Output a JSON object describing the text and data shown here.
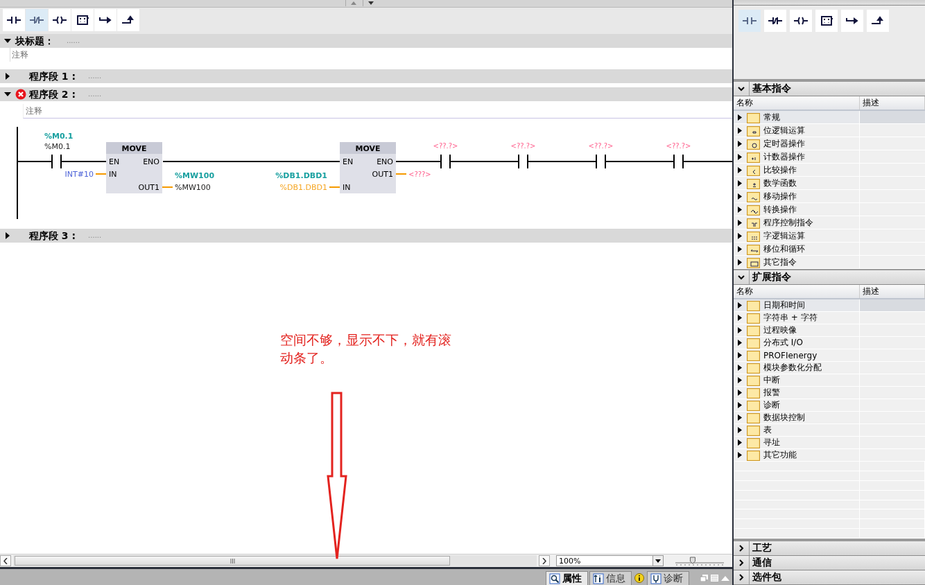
{
  "editor_toolbar": [
    {
      "kind": "no_contact",
      "selected": false
    },
    {
      "kind": "nc_contact",
      "selected": true
    },
    {
      "kind": "coil",
      "selected": false
    },
    {
      "kind": "empty_box",
      "selected": false
    },
    {
      "kind": "open_branch",
      "selected": false
    },
    {
      "kind": "close_branch",
      "selected": false
    }
  ],
  "block_title": {
    "label": "块标题：",
    "value": "......",
    "expanded": true,
    "comment": "注释"
  },
  "networks": [
    {
      "label": "程序段 1 :",
      "value": "......",
      "expanded": false,
      "error": false
    },
    {
      "label": "程序段 2 :",
      "value": "......",
      "expanded": true,
      "error": true,
      "comment": "注释"
    },
    {
      "label": "程序段 3 :",
      "value": "......",
      "expanded": false,
      "error": false
    }
  ],
  "ladder": {
    "contact_symbol": "%M0.1",
    "contact_address": "%M0.1",
    "move_boxes": [
      {
        "title": "MOVE",
        "en": "EN",
        "eno": "ENO",
        "in": "IN",
        "out": "OUT1",
        "in_operand": {
          "text": "INT#10",
          "kind": "constant"
        },
        "out_symbol": "%MW100",
        "out_operand": {
          "text": "%MW100",
          "kind": "address"
        }
      },
      {
        "title": "MOVE",
        "en": "EN",
        "eno": "ENO",
        "in": "IN",
        "out": "OUT1",
        "in_symbol": "%DB1.DBD1",
        "in_operand": {
          "text": "%DB1.DBD1",
          "kind": "db"
        },
        "out_operand": {
          "text": "<???>",
          "kind": "missing"
        }
      }
    ],
    "empty_contacts": [
      {
        "operand": "<??.?>"
      },
      {
        "operand": "<??.?>"
      },
      {
        "operand": "<??.?>"
      },
      {
        "operand": "<??.?>"
      }
    ]
  },
  "annotation": {
    "text": "空间不够，显示不下，就有滚动条了。"
  },
  "zoom": {
    "value": "100%",
    "level": 0.33
  },
  "status_tabs": [
    {
      "label": "属性",
      "kind": "properties",
      "selected": true
    },
    {
      "label": "信息",
      "kind": "info",
      "selected": false
    },
    {
      "label": "诊断",
      "kind": "diagnostics",
      "selected": false
    }
  ],
  "favorites": [
    {
      "kind": "no_contact",
      "selected": true
    },
    {
      "kind": "nc_contact",
      "selected": false
    },
    {
      "kind": "coil",
      "selected": false
    },
    {
      "kind": "empty_box",
      "selected": false
    },
    {
      "kind": "open_branch",
      "selected": false
    },
    {
      "kind": "close_branch",
      "selected": false
    }
  ],
  "palette_sections": [
    {
      "title": "基本指令",
      "expanded": true,
      "columns": [
        "名称",
        "描述"
      ],
      "items": [
        {
          "label": "常规",
          "kind": "plain",
          "selected": true
        },
        {
          "label": "位逻辑运算",
          "kind": "bit",
          "selected": false
        },
        {
          "label": "定时器操作",
          "kind": "timer",
          "selected": false
        },
        {
          "label": "计数器操作",
          "kind": "counter",
          "selected": false
        },
        {
          "label": "比较操作",
          "kind": "compare",
          "selected": false
        },
        {
          "label": "数学函数",
          "kind": "math",
          "selected": false
        },
        {
          "label": "移动操作",
          "kind": "move",
          "selected": false
        },
        {
          "label": "转换操作",
          "kind": "convert",
          "selected": false
        },
        {
          "label": "程序控制指令",
          "kind": "program",
          "selected": false
        },
        {
          "label": "字逻辑运算",
          "kind": "word",
          "selected": false
        },
        {
          "label": "移位和循环",
          "kind": "shift",
          "selected": false
        },
        {
          "label": "其它指令",
          "kind": "other",
          "selected": false
        }
      ]
    },
    {
      "title": "扩展指令",
      "expanded": true,
      "columns": [
        "名称",
        "描述"
      ],
      "items": [
        {
          "label": "日期和时间",
          "kind": "plain",
          "selected": true
        },
        {
          "label": "字符串 + 字符",
          "kind": "plain",
          "selected": false
        },
        {
          "label": "过程映像",
          "kind": "plain",
          "selected": false
        },
        {
          "label": "分布式 I/O",
          "kind": "plain",
          "selected": false
        },
        {
          "label": "PROFIenergy",
          "kind": "plain",
          "selected": false
        },
        {
          "label": "模块参数化分配",
          "kind": "plain",
          "selected": false
        },
        {
          "label": "中断",
          "kind": "plain",
          "selected": false
        },
        {
          "label": "报警",
          "kind": "plain",
          "selected": false
        },
        {
          "label": "诊断",
          "kind": "plain",
          "selected": false
        },
        {
          "label": "数据块控制",
          "kind": "plain",
          "selected": false
        },
        {
          "label": "表",
          "kind": "plain",
          "selected": false
        },
        {
          "label": "寻址",
          "kind": "plain",
          "selected": false
        },
        {
          "label": "其它功能",
          "kind": "plain",
          "selected": false
        }
      ]
    },
    {
      "title": "工艺",
      "expanded": false
    },
    {
      "title": "通信",
      "expanded": false
    },
    {
      "title": "选件包",
      "expanded": false
    }
  ]
}
